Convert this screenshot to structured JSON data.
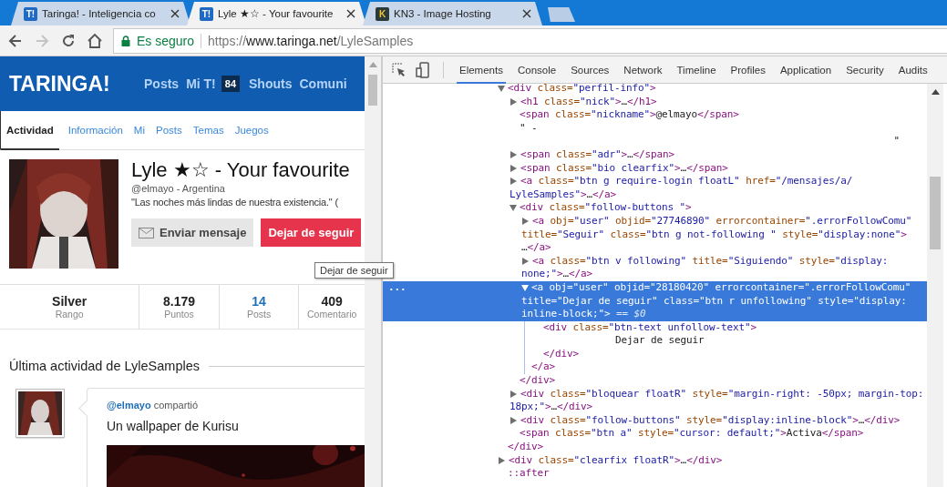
{
  "browser": {
    "tabs": [
      {
        "title": "Taringa! - Inteligencia co",
        "favicon": "T!",
        "kind": "taringa",
        "selected": false
      },
      {
        "title": "Lyle ★☆ - Your favourite",
        "favicon": "T!",
        "kind": "taringa",
        "selected": true
      },
      {
        "title": "KN3 - Image Hosting",
        "favicon": "K",
        "kind": "kn3",
        "selected": false
      }
    ],
    "forward_disabled": true,
    "address": {
      "security": "Es seguro",
      "scheme": "https://",
      "host": "www.taringa.net",
      "path": "/LyleSamples"
    }
  },
  "page": {
    "logo": "TARINGA!",
    "nav": [
      {
        "label": "Posts"
      },
      {
        "label": "Mi T!",
        "badge": "84"
      },
      {
        "label": "Shouts"
      },
      {
        "label": "Comuni"
      }
    ],
    "profile_tabs": [
      {
        "label": "Actividad",
        "selected": true
      },
      {
        "label": "Información",
        "selected": false
      },
      {
        "label": "Mi",
        "selected": false
      },
      {
        "label": "Posts",
        "selected": false
      },
      {
        "label": "Temas",
        "selected": false
      },
      {
        "label": "Juegos",
        "selected": false
      }
    ],
    "profile": {
      "title": "Lyle ★☆ - Your favourite",
      "subtitle": "@elmayo - Argentina",
      "quote": "\"Las noches más lindas de nuestra existencia.\" (",
      "buttons": [
        {
          "label": "Enviar mensaje",
          "kind": "message"
        },
        {
          "label": "Dejar de seguir",
          "kind": "unfollow"
        }
      ]
    },
    "tooltip": "Dejar de seguir",
    "stats": [
      {
        "value": "Silver",
        "label": "Rango",
        "link": false
      },
      {
        "value": "8.179",
        "label": "Puntos",
        "link": false
      },
      {
        "value": "14",
        "label": "Posts",
        "link": true
      },
      {
        "value": "409",
        "label": "Comentario",
        "link": false
      }
    ],
    "activity": {
      "heading": "Última actividad de LyleSamples",
      "items": [
        {
          "actor": "@elmayo",
          "verb": "compartió",
          "text": "Un wallpaper de Kurisu"
        }
      ]
    }
  },
  "devtools": {
    "tabs": [
      {
        "label": "Elements",
        "selected": true
      },
      {
        "label": "Console",
        "selected": false
      },
      {
        "label": "Sources",
        "selected": false
      },
      {
        "label": "Network",
        "selected": false
      },
      {
        "label": "Timeline",
        "selected": false
      },
      {
        "label": "Profiles",
        "selected": false
      },
      {
        "label": "Application",
        "selected": false
      },
      {
        "label": "Security",
        "selected": false
      },
      {
        "label": "Audits",
        "selected": false
      }
    ],
    "gutter_marker": "...",
    "dom": [
      {
        "kind": "toggle",
        "expanded": true,
        "selected": false,
        "lines": [
          [
            {
              "kind": "tag",
              "text": "<div"
            },
            {
              "kind": "attr",
              "text": " class="
            },
            {
              "kind": "value",
              "text": "\"perfil-info\""
            },
            {
              "kind": "tag",
              "text": ">"
            }
          ]
        ],
        "close": [
          {
            "kind": "tag",
            "text": "</div>"
          }
        ],
        "children": [
          {
            "kind": "toggle",
            "expanded": false,
            "selected": false,
            "lines": [
              [
                {
                  "kind": "tag",
                  "text": "<h1"
                },
                {
                  "kind": "attr",
                  "text": " class="
                },
                {
                  "kind": "value",
                  "text": "\"nick\""
                },
                {
                  "kind": "tag",
                  "text": ">"
                },
                {
                  "kind": "text",
                  "text": "…"
                },
                {
                  "kind": "tag",
                  "text": "</h1>"
                }
              ]
            ]
          },
          {
            "kind": "plain",
            "selected": false,
            "lines": [
              [
                {
                  "kind": "tag",
                  "text": "<span"
                },
                {
                  "kind": "attr",
                  "text": " class="
                },
                {
                  "kind": "value",
                  "text": "\"nickname\""
                },
                {
                  "kind": "tag",
                  "text": ">"
                },
                {
                  "kind": "text",
                  "text": "@elmayo"
                },
                {
                  "kind": "tag",
                  "text": "</span>"
                }
              ]
            ]
          },
          {
            "kind": "text",
            "selected": false,
            "lines": [
              [
                {
                  "kind": "text",
                  "text": "\" -"
                }
              ],
              [
                {
                  "kind": "text",
                  "text": "\""
                }
              ]
            ]
          },
          {
            "kind": "toggle",
            "expanded": false,
            "selected": false,
            "lines": [
              [
                {
                  "kind": "tag",
                  "text": "<span"
                },
                {
                  "kind": "attr",
                  "text": " class="
                },
                {
                  "kind": "value",
                  "text": "\"adr\""
                },
                {
                  "kind": "tag",
                  "text": ">"
                },
                {
                  "kind": "text",
                  "text": "…"
                },
                {
                  "kind": "tag",
                  "text": "</span>"
                }
              ]
            ]
          },
          {
            "kind": "toggle",
            "expanded": false,
            "selected": false,
            "lines": [
              [
                {
                  "kind": "tag",
                  "text": "<span"
                },
                {
                  "kind": "attr",
                  "text": " class="
                },
                {
                  "kind": "value",
                  "text": "\"bio clearfix\""
                },
                {
                  "kind": "tag",
                  "text": ">"
                },
                {
                  "kind": "text",
                  "text": "…"
                },
                {
                  "kind": "tag",
                  "text": "</span>"
                }
              ]
            ]
          },
          {
            "kind": "toggle",
            "expanded": false,
            "selected": false,
            "lines": [
              [
                {
                  "kind": "tag",
                  "text": "<a"
                },
                {
                  "kind": "attr",
                  "text": " class="
                },
                {
                  "kind": "value",
                  "text": "\"btn g require-login floatL\""
                },
                {
                  "kind": "attr",
                  "text": " href="
                },
                {
                  "kind": "value",
                  "text": "\"/mensajes/a/"
                }
              ],
              [
                {
                  "kind": "value",
                  "text": "LyleSamples\""
                },
                {
                  "kind": "tag",
                  "text": ">"
                },
                {
                  "kind": "text",
                  "text": "…"
                },
                {
                  "kind": "tag",
                  "text": "</a>"
                }
              ]
            ]
          },
          {
            "kind": "toggle",
            "expanded": true,
            "selected": false,
            "lines": [
              [
                {
                  "kind": "tag",
                  "text": "<div"
                },
                {
                  "kind": "attr",
                  "text": " class="
                },
                {
                  "kind": "value",
                  "text": "\"follow-buttons \""
                },
                {
                  "kind": "tag",
                  "text": ">"
                }
              ]
            ],
            "close": [
              {
                "kind": "tag",
                "text": "</div>"
              }
            ],
            "children": [
              {
                "kind": "toggle",
                "expanded": false,
                "selected": false,
                "lines": [
                  [
                    {
                      "kind": "tag",
                      "text": "<a"
                    },
                    {
                      "kind": "attr",
                      "text": " obj="
                    },
                    {
                      "kind": "value",
                      "text": "\"user\""
                    },
                    {
                      "kind": "attr",
                      "text": " objid="
                    },
                    {
                      "kind": "value",
                      "text": "\"27746890\""
                    },
                    {
                      "kind": "attr",
                      "text": " errorcontainer="
                    },
                    {
                      "kind": "value",
                      "text": "\".errorFollowComu\""
                    }
                  ],
                  [
                    {
                      "kind": "attr",
                      "text": "title="
                    },
                    {
                      "kind": "value",
                      "text": "\"Seguir\""
                    },
                    {
                      "kind": "attr",
                      "text": " class="
                    },
                    {
                      "kind": "value",
                      "text": "\"btn g not-following \""
                    },
                    {
                      "kind": "attr",
                      "text": " style="
                    },
                    {
                      "kind": "value",
                      "text": "\"display:none\""
                    },
                    {
                      "kind": "tag",
                      "text": ">"
                    }
                  ],
                  [
                    {
                      "kind": "text",
                      "text": "…"
                    },
                    {
                      "kind": "tag",
                      "text": "</a>"
                    }
                  ]
                ]
              },
              {
                "kind": "toggle",
                "expanded": false,
                "selected": false,
                "lines": [
                  [
                    {
                      "kind": "tag",
                      "text": "<a"
                    },
                    {
                      "kind": "attr",
                      "text": " class="
                    },
                    {
                      "kind": "value",
                      "text": "\"btn v following\""
                    },
                    {
                      "kind": "attr",
                      "text": " title="
                    },
                    {
                      "kind": "value",
                      "text": "\"Siguiendo\""
                    },
                    {
                      "kind": "attr",
                      "text": " style="
                    },
                    {
                      "kind": "value",
                      "text": "\"display:"
                    }
                  ],
                  [
                    {
                      "kind": "value",
                      "text": "none;\""
                    },
                    {
                      "kind": "tag",
                      "text": ">"
                    },
                    {
                      "kind": "text",
                      "text": "…"
                    },
                    {
                      "kind": "tag",
                      "text": "</a>"
                    }
                  ]
                ]
              },
              {
                "kind": "toggle",
                "expanded": true,
                "selected": true,
                "lines": [
                  [
                    {
                      "kind": "tag",
                      "text": "<a"
                    },
                    {
                      "kind": "attr",
                      "text": " obj="
                    },
                    {
                      "kind": "value",
                      "text": "\"user\""
                    },
                    {
                      "kind": "attr",
                      "text": " objid="
                    },
                    {
                      "kind": "value",
                      "text": "\"28180420\""
                    },
                    {
                      "kind": "attr",
                      "text": " errorcontainer="
                    },
                    {
                      "kind": "value",
                      "text": "\".errorFollowComu\""
                    }
                  ],
                  [
                    {
                      "kind": "attr",
                      "text": "title="
                    },
                    {
                      "kind": "value",
                      "text": "\"Dejar de seguir\""
                    },
                    {
                      "kind": "attr",
                      "text": " class="
                    },
                    {
                      "kind": "value",
                      "text": "\"btn r unfollowing\""
                    },
                    {
                      "kind": "attr",
                      "text": " style="
                    },
                    {
                      "kind": "value",
                      "text": "\"display:"
                    }
                  ],
                  [
                    {
                      "kind": "value",
                      "text": "inline-block;\""
                    },
                    {
                      "kind": "tag",
                      "text": ">"
                    },
                    {
                      "kind": "marker",
                      "text": " == $0"
                    }
                  ]
                ],
                "close": [
                  {
                    "kind": "tag",
                    "text": "</a>"
                  }
                ],
                "children": [
                  {
                    "kind": "plain",
                    "selected": false,
                    "lines": [
                      [
                        {
                          "kind": "tag",
                          "text": "<div"
                        },
                        {
                          "kind": "attr",
                          "text": " class="
                        },
                        {
                          "kind": "value",
                          "text": "\"btn-text unfollow-text\""
                        },
                        {
                          "kind": "tag",
                          "text": ">"
                        }
                      ]
                    ],
                    "close": [
                      {
                        "kind": "tag",
                        "text": "</div>"
                      }
                    ],
                    "children": [
                      {
                        "kind": "text",
                        "selected": false,
                        "lines": [
                          [
                            {
                              "kind": "text",
                              "text": "Dejar de seguir"
                            }
                          ]
                        ]
                      }
                    ]
                  }
                ]
              }
            ]
          },
          {
            "kind": "toggle",
            "expanded": false,
            "selected": false,
            "lines": [
              [
                {
                  "kind": "tag",
                  "text": "<div"
                },
                {
                  "kind": "attr",
                  "text": " class="
                },
                {
                  "kind": "value",
                  "text": "\"bloquear floatR\""
                },
                {
                  "kind": "attr",
                  "text": " style="
                },
                {
                  "kind": "value",
                  "text": "\"margin-right: -50px; margin-top:"
                }
              ],
              [
                {
                  "kind": "value",
                  "text": "18px;\""
                },
                {
                  "kind": "tag",
                  "text": ">"
                },
                {
                  "kind": "text",
                  "text": "…"
                },
                {
                  "kind": "tag",
                  "text": "</div>"
                }
              ]
            ]
          },
          {
            "kind": "toggle",
            "expanded": false,
            "selected": false,
            "lines": [
              [
                {
                  "kind": "tag",
                  "text": "<div"
                },
                {
                  "kind": "attr",
                  "text": " class="
                },
                {
                  "kind": "value",
                  "text": "\"follow-buttons\""
                },
                {
                  "kind": "attr",
                  "text": " style="
                },
                {
                  "kind": "value",
                  "text": "\"display:inline-block\""
                },
                {
                  "kind": "tag",
                  "text": ">"
                },
                {
                  "kind": "text",
                  "text": "…"
                },
                {
                  "kind": "tag",
                  "text": "</div>"
                }
              ]
            ]
          },
          {
            "kind": "plain",
            "selected": false,
            "lines": [
              [
                {
                  "kind": "tag",
                  "text": "<span"
                },
                {
                  "kind": "attr",
                  "text": " class="
                },
                {
                  "kind": "value",
                  "text": "\"btn a\""
                },
                {
                  "kind": "attr",
                  "text": " style="
                },
                {
                  "kind": "value",
                  "text": "\"cursor: default;\""
                },
                {
                  "kind": "tag",
                  "text": ">"
                },
                {
                  "kind": "text",
                  "text": "Activa"
                },
                {
                  "kind": "tag",
                  "text": "</span>"
                }
              ]
            ]
          }
        ]
      },
      {
        "kind": "toggle",
        "expanded": false,
        "selected": false,
        "lines": [
          [
            {
              "kind": "tag",
              "text": "<div"
            },
            {
              "kind": "attr",
              "text": " class="
            },
            {
              "kind": "value",
              "text": "\"clearfix floatR\""
            },
            {
              "kind": "tag",
              "text": ">"
            },
            {
              "kind": "text",
              "text": "…"
            },
            {
              "kind": "tag",
              "text": "</div>"
            }
          ]
        ]
      },
      {
        "kind": "plain",
        "selected": false,
        "lines": [
          [
            {
              "kind": "tag",
              "text": "::after"
            }
          ]
        ]
      }
    ]
  }
}
